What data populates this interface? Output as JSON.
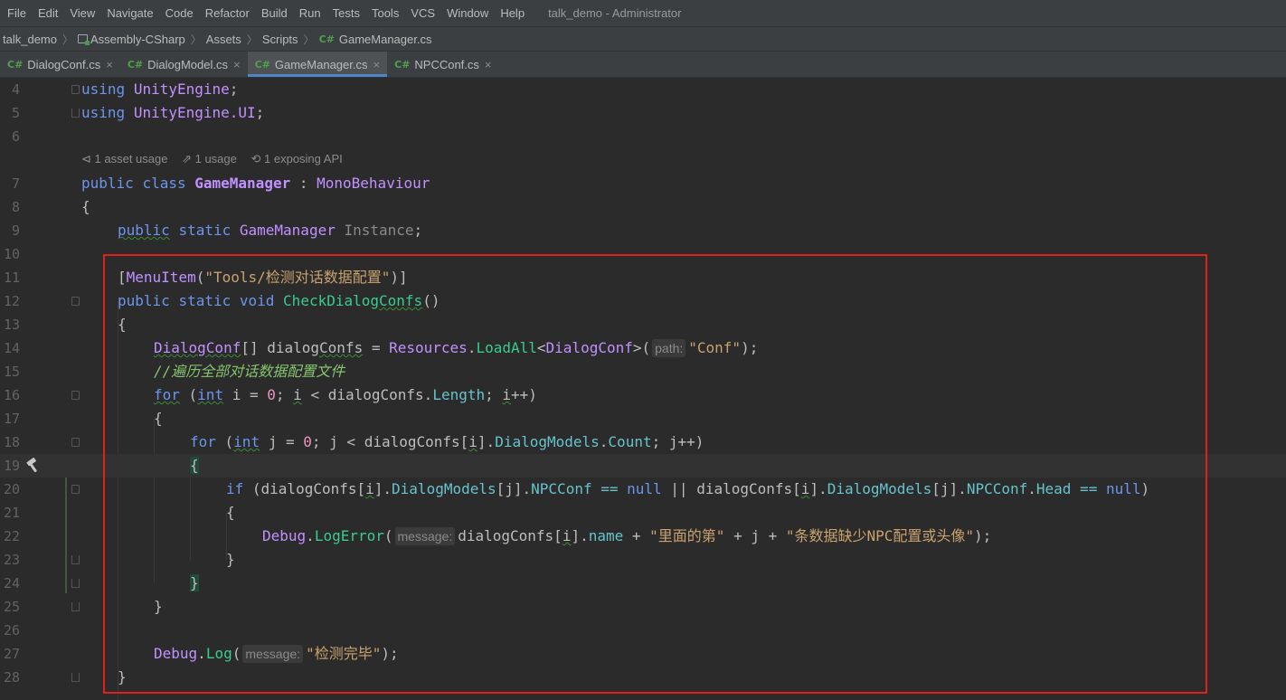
{
  "menu": [
    "File",
    "Edit",
    "View",
    "Navigate",
    "Code",
    "Refactor",
    "Build",
    "Run",
    "Tests",
    "Tools",
    "VCS",
    "Window",
    "Help"
  ],
  "window_title": "talk_demo - Administrator",
  "breadcrumb": [
    "talk_demo",
    "Assembly-CSharp",
    "Assets",
    "Scripts",
    "GameManager.cs"
  ],
  "tabs": [
    {
      "label": "DialogConf.cs",
      "active": false
    },
    {
      "label": "DialogModel.cs",
      "active": false
    },
    {
      "label": "GameManager.cs",
      "active": true
    },
    {
      "label": "NPCConf.cs",
      "active": false
    }
  ],
  "icons": {
    "cs": "C#",
    "close": "×",
    "breadcrumb_sep": "〉"
  },
  "inlay": {
    "asset_usage": "1 asset usage",
    "usage": "1 usage",
    "exposing_api": "1 exposing API"
  },
  "line_numbers": [
    "4",
    "5",
    "6",
    "7",
    "8",
    "9",
    "10",
    "11",
    "12",
    "13",
    "14",
    "15",
    "16",
    "17",
    "18",
    "19",
    "20",
    "21",
    "22",
    "23",
    "24",
    "25",
    "26",
    "27",
    "28"
  ],
  "code": {
    "l4": [
      "using",
      " ",
      "UnityEngine",
      ";"
    ],
    "l5": [
      "using",
      " ",
      "UnityEngine.UI",
      ";"
    ],
    "l7": [
      "public",
      " ",
      "class",
      " ",
      "GameManager",
      " : ",
      "MonoBehaviour"
    ],
    "l8": "{",
    "l9": [
      "public",
      " ",
      "static",
      " ",
      "GameManager",
      " ",
      "Instance",
      ";"
    ],
    "l11": [
      "[",
      "MenuItem",
      "(",
      "\"Tools/检测对话数据配置\"",
      ")]"
    ],
    "l12": [
      "public",
      " ",
      "static",
      " ",
      "void",
      " ",
      "CheckDialog",
      "Confs",
      "()"
    ],
    "l13": "{",
    "l14": [
      "DialogConf",
      "[] dialog",
      "Confs",
      " = ",
      "Resources",
      ".",
      "LoadAll",
      "<",
      "DialogConf",
      ">(",
      "path:",
      "\"Conf\"",
      ");"
    ],
    "l15": "//遍历全部对话数据配置文件",
    "l16": [
      "for",
      " (",
      "int",
      " ",
      "i",
      " = ",
      "0",
      "; ",
      "i",
      " < dialogConfs.",
      "Length",
      "; ",
      "i",
      "++)"
    ],
    "l17": "{",
    "l18": [
      "for",
      " (",
      "int",
      " j = ",
      "0",
      "; j < dialogConfs[",
      "i",
      "].",
      "DialogModels",
      ".",
      "Count",
      "; j++)"
    ],
    "l19": "{",
    "l20": [
      "if",
      " (dialogConfs[",
      "i",
      "].",
      "DialogModels",
      "[j].",
      "NPCConf",
      " == ",
      "null",
      " || dialogConfs[",
      "i",
      "].",
      "DialogModels",
      "[j].",
      "NPCConf",
      ".",
      "Head",
      " == ",
      "null",
      ")"
    ],
    "l21": "{",
    "l22": [
      "Debug",
      ".",
      "LogError",
      "(",
      "message:",
      "dialogConfs[",
      "i",
      "].",
      "name",
      " + ",
      "\"里面的第\"",
      " + j + ",
      "\"条数据缺少NPC配置或头像\"",
      ");"
    ],
    "l23": "}",
    "l24": "}",
    "l25": "}",
    "l27": [
      "Debug",
      ".",
      "Log",
      "(",
      "message:",
      "\"检测完毕\"",
      ");"
    ],
    "l28": "}"
  },
  "colors": {
    "keyword": "#6c95eb",
    "type": "#c191ff",
    "method": "#39cc8f",
    "member": "#66c3cc",
    "string": "#c9a26d",
    "number": "#ed94c0",
    "comment": "#85c46c",
    "highlight_box": "#e0201b"
  }
}
